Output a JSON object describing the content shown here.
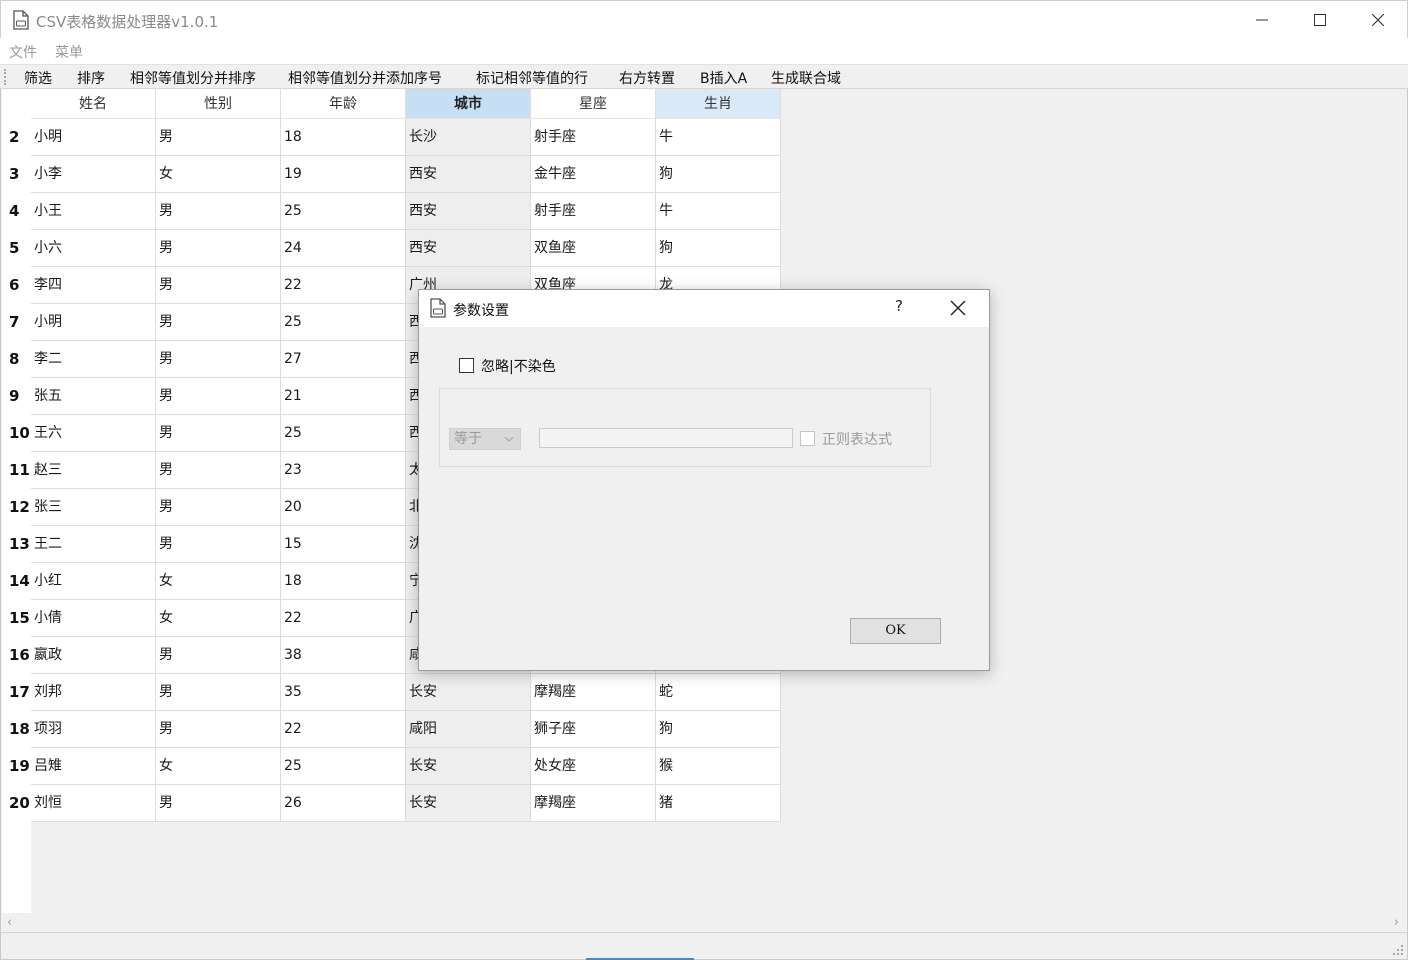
{
  "window": {
    "title": "CSV表格数据处理器v1.0.1"
  },
  "menubar": {
    "items": [
      "文件",
      "菜单"
    ]
  },
  "toolbar": {
    "items": [
      "筛选",
      "排序",
      "相邻等值划分并排序",
      "相邻等值划分并添加序号",
      "标记相邻等值的行",
      "右方转置",
      "B插入A",
      "生成联合域"
    ]
  },
  "table": {
    "columns": [
      "姓名",
      "性别",
      "年龄",
      "城市",
      "星座",
      "生肖"
    ],
    "selected_column": "城市",
    "rows": [
      {
        "n": "2",
        "cells": [
          "小明",
          "男",
          "18",
          "长沙",
          "射手座",
          "牛"
        ]
      },
      {
        "n": "3",
        "cells": [
          "小李",
          "女",
          "19",
          "西安",
          "金牛座",
          "狗"
        ]
      },
      {
        "n": "4",
        "cells": [
          "小王",
          "男",
          "25",
          "西安",
          "射手座",
          "牛"
        ]
      },
      {
        "n": "5",
        "cells": [
          "小六",
          "男",
          "24",
          "西安",
          "双鱼座",
          "狗"
        ]
      },
      {
        "n": "6",
        "cells": [
          "李四",
          "男",
          "22",
          "广州",
          "双鱼座",
          "龙"
        ]
      },
      {
        "n": "7",
        "cells": [
          "小明",
          "男",
          "25",
          "西",
          "",
          ""
        ]
      },
      {
        "n": "8",
        "cells": [
          "李二",
          "男",
          "27",
          "西",
          "",
          ""
        ]
      },
      {
        "n": "9",
        "cells": [
          "张五",
          "男",
          "21",
          "西",
          "",
          ""
        ]
      },
      {
        "n": "10",
        "cells": [
          "王六",
          "男",
          "25",
          "西",
          "",
          ""
        ]
      },
      {
        "n": "11",
        "cells": [
          "赵三",
          "男",
          "23",
          "太",
          "",
          ""
        ]
      },
      {
        "n": "12",
        "cells": [
          "张三",
          "男",
          "20",
          "北",
          "",
          ""
        ]
      },
      {
        "n": "13",
        "cells": [
          "王二",
          "男",
          "15",
          "沈",
          "",
          ""
        ]
      },
      {
        "n": "14",
        "cells": [
          "小红",
          "女",
          "18",
          "宁",
          "",
          ""
        ]
      },
      {
        "n": "15",
        "cells": [
          "小倩",
          "女",
          "22",
          "广",
          "",
          ""
        ]
      },
      {
        "n": "16",
        "cells": [
          "嬴政",
          "男",
          "38",
          "咸",
          "",
          ""
        ]
      },
      {
        "n": "17",
        "cells": [
          "刘邦",
          "男",
          "35",
          "长安",
          "摩羯座",
          "蛇"
        ]
      },
      {
        "n": "18",
        "cells": [
          "项羽",
          "男",
          "22",
          "咸阳",
          "狮子座",
          "狗"
        ]
      },
      {
        "n": "19",
        "cells": [
          "吕雉",
          "女",
          "25",
          "长安",
          "处女座",
          "猴"
        ]
      },
      {
        "n": "20",
        "cells": [
          "刘恒",
          "男",
          "26",
          "长安",
          "摩羯座",
          "猪"
        ]
      }
    ]
  },
  "dialog": {
    "title": "参数设置",
    "help": "?",
    "ignore_checkbox_label": "忽略|不染色",
    "ignore_checked": false,
    "operator_value": "等于",
    "pattern_value": "",
    "regex_checkbox_label": "正则表达式",
    "regex_checked": false,
    "ok_label": "OK"
  },
  "colors": {
    "header_selected": "#c7dff4",
    "header_selected_light": "#d9e9f7",
    "column_selected_bg": "#eeeeee",
    "toolbar_bg": "#f0f0f0",
    "accent": "#4a86c8"
  }
}
